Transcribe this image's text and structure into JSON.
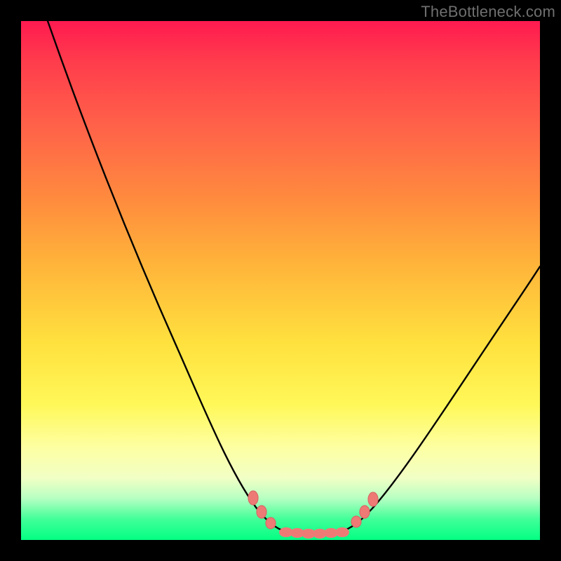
{
  "watermark": "TheBottleneck.com",
  "colors": {
    "background_frame": "#000000",
    "gradient_top": "#ff1a50",
    "gradient_bottom": "#04ff83",
    "curve": "#000000",
    "marker": "#ee7a76"
  },
  "chart_data": {
    "type": "line",
    "title": "",
    "xlabel": "",
    "ylabel": "",
    "xlim": [
      0,
      100
    ],
    "ylim": [
      0,
      100
    ],
    "grid": false,
    "legend": false,
    "notes": "Chart is a bottleneck-style curve. No numeric axis ticks are rendered in the image; values below are positional estimates (percentage of plot width/height, y=0 at bottom). A second branch starting after x≈62 rises to the right.",
    "x": [
      0,
      4,
      10,
      16,
      22,
      28,
      34,
      38,
      42,
      46,
      50,
      54,
      58,
      62,
      66,
      72,
      78,
      84,
      90,
      96,
      100
    ],
    "values": [
      100,
      92,
      80,
      66,
      52,
      40,
      26,
      18,
      11,
      6,
      3,
      1.5,
      1,
      1,
      2,
      6,
      12,
      20,
      30,
      40,
      48
    ],
    "flat_region_x": [
      50,
      62
    ],
    "markers_left": [
      {
        "x": 44,
        "y": 10
      },
      {
        "x": 46,
        "y": 7
      },
      {
        "x": 47.5,
        "y": 5
      }
    ],
    "markers_right": [
      {
        "x": 64,
        "y": 3
      },
      {
        "x": 65.5,
        "y": 5
      },
      {
        "x": 67,
        "y": 7
      }
    ],
    "markers_flat": [
      {
        "x": 50,
        "y": 1
      },
      {
        "x": 52,
        "y": 1
      },
      {
        "x": 54,
        "y": 1
      },
      {
        "x": 56,
        "y": 1
      },
      {
        "x": 58,
        "y": 1
      },
      {
        "x": 60,
        "y": 1
      },
      {
        "x": 62,
        "y": 1
      }
    ]
  }
}
